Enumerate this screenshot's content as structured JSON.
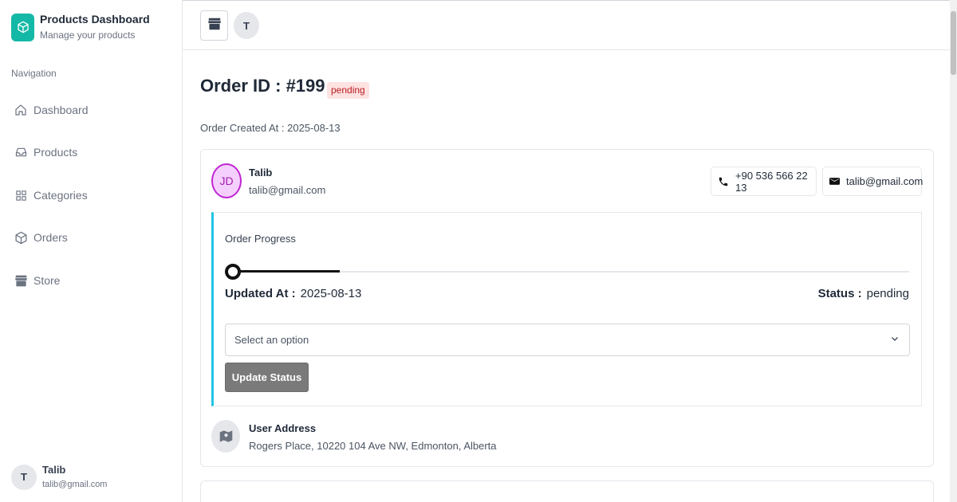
{
  "brand": {
    "title": "Products Dashboard",
    "subtitle": "Manage your products",
    "logo_icon": "cube-icon",
    "accent": "#14b8a6"
  },
  "sidebar": {
    "section_label": "Navigation",
    "items": [
      {
        "label": "Dashboard",
        "icon": "home-icon"
      },
      {
        "label": "Products",
        "icon": "inbox-icon"
      },
      {
        "label": "Categories",
        "icon": "grid-icon"
      },
      {
        "label": "Orders",
        "icon": "box-icon"
      },
      {
        "label": "Store",
        "icon": "store-icon"
      }
    ],
    "user": {
      "initial": "T",
      "name": "Talib",
      "email": "talib@gmail.com"
    }
  },
  "topbar": {
    "store_icon": "store-icon",
    "avatar_initial": "T"
  },
  "order": {
    "title": "Order ID : #199",
    "status_badge": "pending",
    "created_at": "Order Created At : 2025-08-13"
  },
  "customer": {
    "initials": "JD",
    "name": "Talib",
    "email": "talib@gmail.com",
    "phone": "+90 536 566 22 13",
    "contact_email": "talib@gmail.com"
  },
  "progress": {
    "label": "Order Progress",
    "fraction": 0.16,
    "updated_label": "Updated At :",
    "updated_value": "2025-08-13",
    "status_label": "Status :",
    "status_value": "pending"
  },
  "status_select": {
    "placeholder": "Select an option"
  },
  "update_button": "Update Status",
  "address": {
    "title": "User Address",
    "text": "Rogers Place, 10220 104 Ave NW, Edmonton, Alberta"
  }
}
